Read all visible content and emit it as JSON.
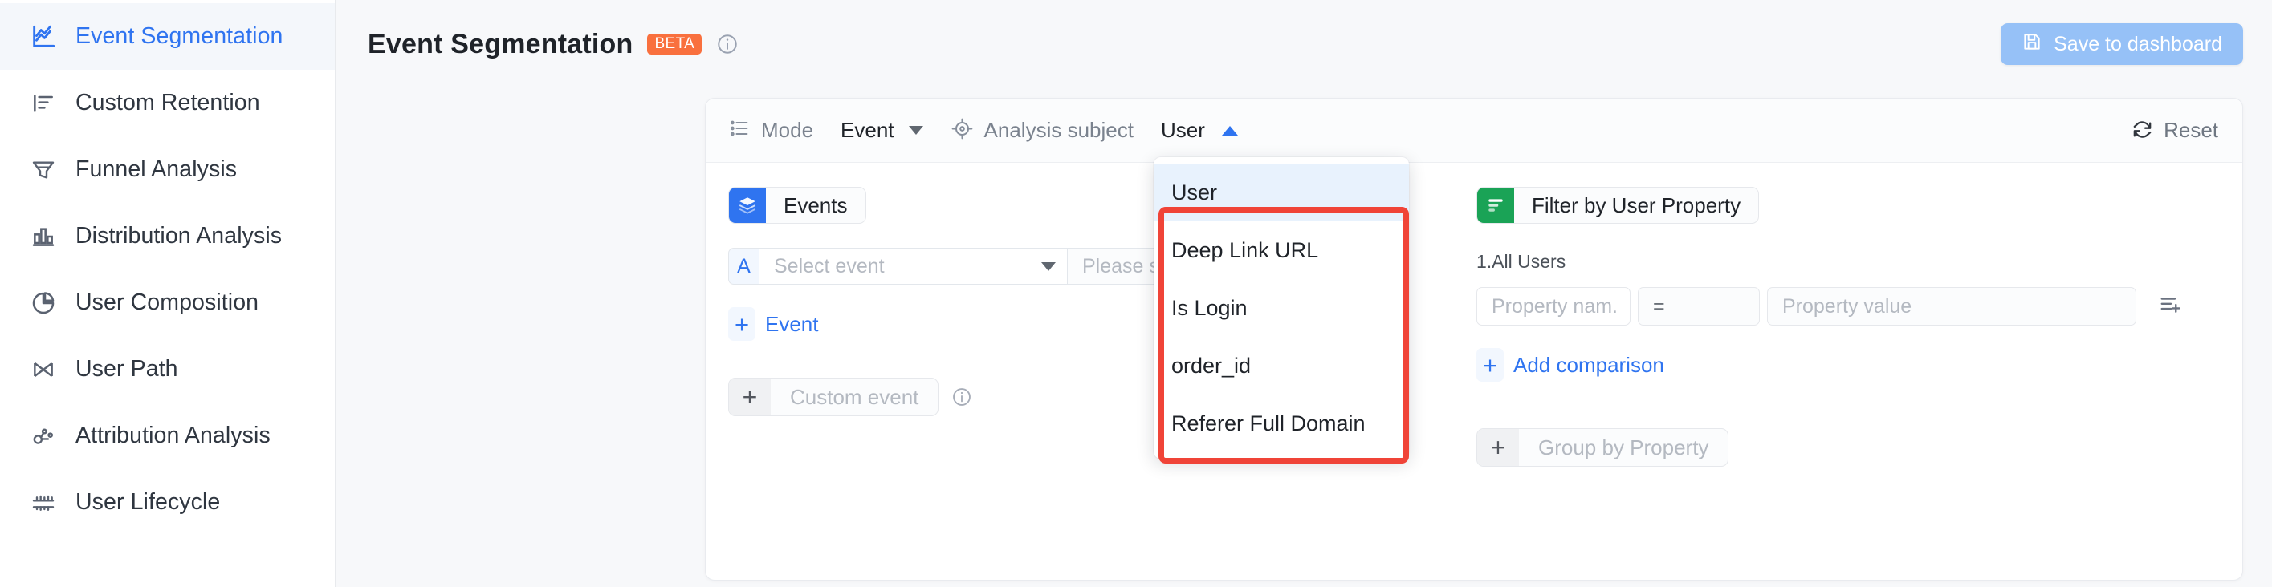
{
  "sidebar": {
    "items": [
      {
        "label": "Event Segmentation",
        "icon": "line-chart-icon",
        "active": true
      },
      {
        "label": "Custom Retention",
        "icon": "retention-bars-icon",
        "active": false
      },
      {
        "label": "Funnel Analysis",
        "icon": "funnel-icon",
        "active": false
      },
      {
        "label": "Distribution Analysis",
        "icon": "bar-chart-icon",
        "active": false
      },
      {
        "label": "User Composition",
        "icon": "pie-chart-icon",
        "active": false
      },
      {
        "label": "User Path",
        "icon": "path-icon",
        "active": false
      },
      {
        "label": "Attribution Analysis",
        "icon": "attribution-icon",
        "active": false
      },
      {
        "label": "User Lifecycle",
        "icon": "lifecycle-icon",
        "active": false
      }
    ]
  },
  "header": {
    "title": "Event Segmentation",
    "badge": "BETA",
    "info_icon": "info-circle-icon",
    "save_button": {
      "label": "Save to dashboard",
      "icon": "floppy-disk-icon",
      "color": "#96c1f7"
    }
  },
  "toolbar": {
    "mode_icon": "list-mode-icon",
    "mode_label": "Mode",
    "mode_value": "Event",
    "subject_icon": "target-icon",
    "subject_label": "Analysis subject",
    "subject_value": "User",
    "subject_caret": "caret-up-icon",
    "reset_label": "Reset",
    "reset_icon": "refresh-icon"
  },
  "events_panel": {
    "chip_label": "Events",
    "chip_icon": "layers-icon",
    "chip_color": "#2f74f0",
    "rows": [
      {
        "badge": "A",
        "event_placeholder": "Select event",
        "caret": "caret-down-icon",
        "aggregate_placeholder": "Please select"
      }
    ],
    "add_event_label": "Event",
    "add_event_icon": "plus-icon",
    "custom_event_placeholder": "Custom event",
    "custom_event_icon": "plus-icon",
    "custom_event_info_icon": "info-circle-icon",
    "row_tools": [
      "sort-add-icon",
      "more-ellipsis-icon"
    ]
  },
  "filter_panel": {
    "chip_label": "Filter by User Property",
    "chip_icon": "filter-icon",
    "chip_color": "#1aa356",
    "subtitle": "1.All Users",
    "property_name_placeholder": "Property nam.",
    "operator_value": "=",
    "property_value_placeholder": "Property value",
    "tail_icon": "sort-add-icon",
    "add_comparison_label": "Add comparison",
    "add_comparison_icon": "plus-icon",
    "group_by_placeholder": "Group by Property",
    "group_by_icon": "plus-icon"
  },
  "dropdown": {
    "selected": "User",
    "items": [
      "User",
      "Deep Link URL",
      "Is Login",
      "order_id",
      "Referer Full Domain"
    ],
    "annotation_color": "#f04438"
  }
}
